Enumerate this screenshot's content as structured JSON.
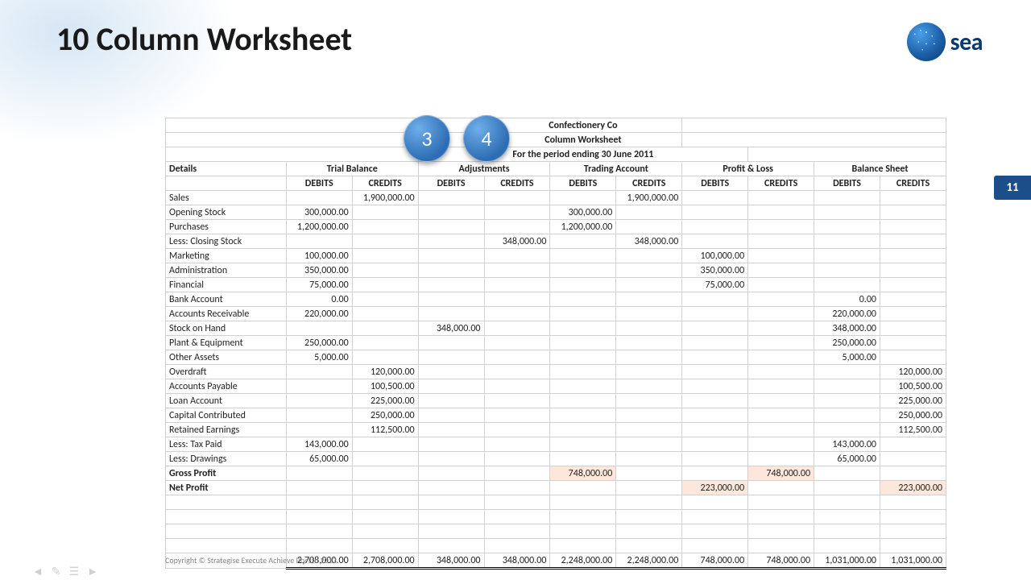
{
  "slide": {
    "title": "10 Column Worksheet",
    "page_number": "11"
  },
  "logo": {
    "text": "sea"
  },
  "badges": {
    "a": "3",
    "b": "4"
  },
  "footer": {
    "text": "Copyright © Strategise Execute Achieve Pty Ltd 2013"
  },
  "sheet": {
    "company": "Confectionery Co",
    "subtitle": "Column Worksheet",
    "period": "For the period ending 30 June 2011",
    "details_label": "Details",
    "groups": [
      "Trial Balance",
      "Adjustments",
      "Trading Account",
      "Profit & Loss",
      "Balance Sheet"
    ],
    "subcols": {
      "debit": "DEBITS",
      "credit": "CREDITS"
    },
    "rows": [
      {
        "d": "Sales",
        "c": [
          "",
          "1,900,000.00",
          "",
          "",
          "",
          "1,900,000.00",
          "",
          "",
          "",
          ""
        ]
      },
      {
        "d": "Opening Stock",
        "c": [
          "300,000.00",
          "",
          "",
          "",
          "300,000.00",
          "",
          "",
          "",
          "",
          ""
        ]
      },
      {
        "d": "Purchases",
        "c": [
          "1,200,000.00",
          "",
          "",
          "",
          "1,200,000.00",
          "",
          "",
          "",
          "",
          ""
        ]
      },
      {
        "d": "Less: Closing Stock",
        "c": [
          "",
          "",
          "",
          "348,000.00",
          "",
          "348,000.00",
          "",
          "",
          "",
          ""
        ]
      },
      {
        "d": "Marketing",
        "c": [
          "100,000.00",
          "",
          "",
          "",
          "",
          "",
          "100,000.00",
          "",
          "",
          ""
        ]
      },
      {
        "d": "Administration",
        "c": [
          "350,000.00",
          "",
          "",
          "",
          "",
          "",
          "350,000.00",
          "",
          "",
          ""
        ]
      },
      {
        "d": "Financial",
        "c": [
          "75,000.00",
          "",
          "",
          "",
          "",
          "",
          "75,000.00",
          "",
          "",
          ""
        ]
      },
      {
        "d": "Bank Account",
        "c": [
          "0.00",
          "",
          "",
          "",
          "",
          "",
          "",
          "",
          "0.00",
          ""
        ]
      },
      {
        "d": "Accounts Receivable",
        "c": [
          "220,000.00",
          "",
          "",
          "",
          "",
          "",
          "",
          "",
          "220,000.00",
          ""
        ]
      },
      {
        "d": "Stock on Hand",
        "c": [
          "",
          "",
          "348,000.00",
          "",
          "",
          "",
          "",
          "",
          "348,000.00",
          ""
        ]
      },
      {
        "d": "Plant & Equipment",
        "c": [
          "250,000.00",
          "",
          "",
          "",
          "",
          "",
          "",
          "",
          "250,000.00",
          ""
        ]
      },
      {
        "d": "Other Assets",
        "c": [
          "5,000.00",
          "",
          "",
          "",
          "",
          "",
          "",
          "",
          "5,000.00",
          ""
        ]
      },
      {
        "d": "Overdraft",
        "c": [
          "",
          "120,000.00",
          "",
          "",
          "",
          "",
          "",
          "",
          "",
          "120,000.00"
        ]
      },
      {
        "d": "Accounts Payable",
        "c": [
          "",
          "100,500.00",
          "",
          "",
          "",
          "",
          "",
          "",
          "",
          "100,500.00"
        ]
      },
      {
        "d": "Loan Account",
        "c": [
          "",
          "225,000.00",
          "",
          "",
          "",
          "",
          "",
          "",
          "",
          "225,000.00"
        ]
      },
      {
        "d": "Capital Contributed",
        "c": [
          "",
          "250,000.00",
          "",
          "",
          "",
          "",
          "",
          "",
          "",
          "250,000.00"
        ]
      },
      {
        "d": "Retained Earnings",
        "c": [
          "",
          "112,500.00",
          "",
          "",
          "",
          "",
          "",
          "",
          "",
          "112,500.00"
        ]
      },
      {
        "d": "Less: Tax Paid",
        "c": [
          "143,000.00",
          "",
          "",
          "",
          "",
          "",
          "",
          "",
          "143,000.00",
          ""
        ]
      },
      {
        "d": "Less: Drawings",
        "c": [
          "65,000.00",
          "",
          "",
          "",
          "",
          "",
          "",
          "",
          "65,000.00",
          ""
        ]
      },
      {
        "d": "Gross Profit",
        "bold": true,
        "hl": [
          4,
          7
        ],
        "c": [
          "",
          "",
          "",
          "",
          "748,000.00",
          "",
          "",
          "748,000.00",
          "",
          ""
        ]
      },
      {
        "d": "Net Profit",
        "bold": true,
        "hl": [
          6,
          9
        ],
        "c": [
          "",
          "",
          "",
          "",
          "",
          "",
          "223,000.00",
          "",
          "",
          "223,000.00"
        ]
      }
    ],
    "totals": [
      "2,708,000.00",
      "2,708,000.00",
      "348,000.00",
      "348,000.00",
      "2,248,000.00",
      "2,248,000.00",
      "748,000.00",
      "748,000.00",
      "1,031,000.00",
      "1,031,000.00"
    ]
  }
}
